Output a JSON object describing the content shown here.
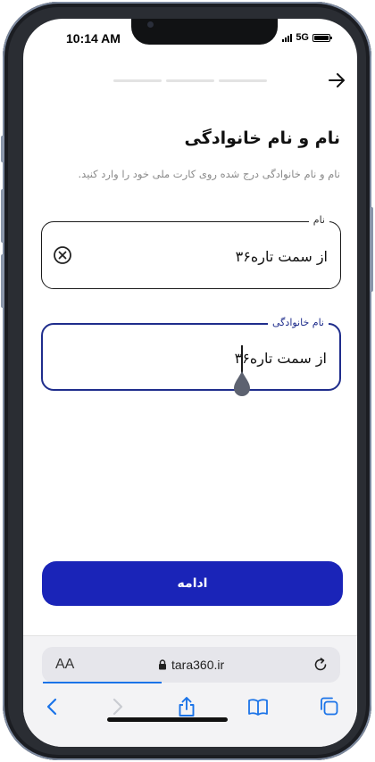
{
  "status": {
    "time": "10:14 AM",
    "network": "5G"
  },
  "progress": {
    "current_step": 1,
    "total_steps": 3
  },
  "form": {
    "title": "نام و نام خانوادگی",
    "subtitle": "نام و نام خانوادگی درج شده روی کارت ملی خود را وارد کنید.",
    "first_name": {
      "label": "نام",
      "value": "از سمت تاره۳۶"
    },
    "last_name": {
      "label": "نام خانوادگی",
      "value": "از سمت تاره۳۶"
    },
    "continue_label": "ادامه"
  },
  "browser": {
    "aa_label": "AA",
    "url": "tara360.ir",
    "toolbar_icons": [
      "back-icon",
      "forward-icon",
      "share-icon",
      "bookmarks-icon",
      "tabs-icon"
    ]
  },
  "colors": {
    "primary": "#1a24b8",
    "focus_border": "#1f2d8c",
    "link_accent": "#1a73e8"
  }
}
